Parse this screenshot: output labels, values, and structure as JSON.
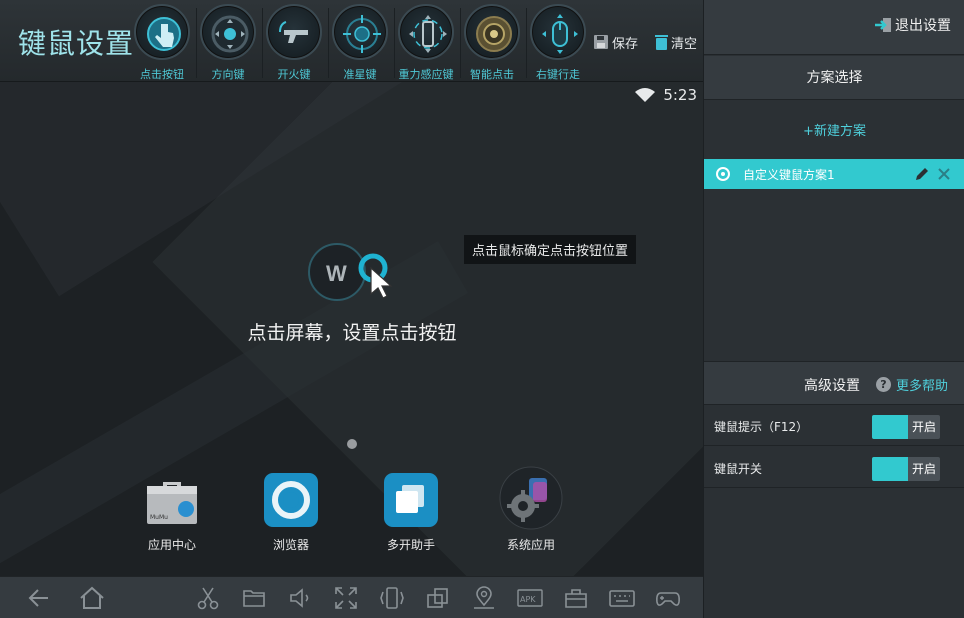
{
  "app": {
    "title": "键鼠设置"
  },
  "toolbar": {
    "tools": [
      {
        "label": "点击按钮",
        "icon": "tap-hand-icon"
      },
      {
        "label": "方向键",
        "icon": "dpad-icon"
      },
      {
        "label": "开火键",
        "icon": "gun-icon"
      },
      {
        "label": "准星键",
        "icon": "crosshair-icon"
      },
      {
        "label": "重力感应键",
        "icon": "gravity-sensor-icon"
      },
      {
        "label": "智能点击",
        "icon": "smart-tap-icon"
      },
      {
        "label": "右键行走",
        "icon": "mouse-icon"
      }
    ],
    "save_label": "保存",
    "clear_label": "清空"
  },
  "screen": {
    "time": "5:23",
    "logo_letter": "W",
    "tooltip": "点击鼠标确定点击按钮位置",
    "hint": "点击屏幕，设置点击按钮",
    "apps": [
      {
        "name": "应用中心",
        "icon": "app-center-icon"
      },
      {
        "name": "浏览器",
        "icon": "browser-icon"
      },
      {
        "name": "多开助手",
        "icon": "multi-instance-icon"
      },
      {
        "name": "系统应用",
        "icon": "system-apps-icon"
      }
    ]
  },
  "navbar": {
    "icons": [
      "back-icon",
      "home-icon",
      "scissors-icon",
      "folder-icon",
      "volume-icon",
      "fullscreen-icon",
      "shake-icon",
      "rotate-icon",
      "location-icon",
      "apk-install-icon",
      "toolbox-icon",
      "keyboard-icon",
      "gamepad-icon"
    ]
  },
  "panel": {
    "exit_label": "退出设置",
    "scheme_heading": "方案选择",
    "new_scheme": "+新建方案",
    "scheme_name": "自定义键鼠方案1",
    "advanced_heading": "高级设置",
    "help_label": "更多帮助",
    "settings": [
      {
        "label": "键鼠提示（F12）",
        "state": "开启"
      },
      {
        "label": "键鼠开关",
        "state": "开启"
      }
    ]
  },
  "colors": {
    "accent": "#32c9cf",
    "link": "#4fd0dc",
    "title": "#9fe3ea"
  }
}
